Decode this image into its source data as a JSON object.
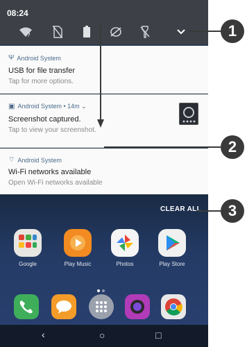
{
  "status_bar": {
    "time": "08:24",
    "quick_settings": [
      {
        "name": "wifi-unknown-icon"
      },
      {
        "name": "no-sim-icon"
      },
      {
        "name": "battery-icon"
      },
      {
        "name": "location-off-icon"
      },
      {
        "name": "flashlight-off-icon"
      },
      {
        "name": "expand-chevron-icon"
      }
    ]
  },
  "notifications": [
    {
      "app": "Android System",
      "title": "USB for file transfer",
      "subtitle": "Tap for more options.",
      "icon": "usb-icon"
    },
    {
      "app": "Android System • 14m ⌄",
      "title": "Screenshot captured.",
      "subtitle": "Tap to view your screenshot.",
      "icon": "image-icon"
    },
    {
      "app": "Android System",
      "title": "Wi-Fi networks available",
      "subtitle": "Open Wi-Fi networks available",
      "icon": "wifi-icon"
    }
  ],
  "home": {
    "clear_all": "CLEAR ALL",
    "apps": [
      {
        "label": "Google",
        "color": "#e8e6e3"
      },
      {
        "label": "Play Music",
        "color": "#f28b21"
      },
      {
        "label": "Photos",
        "color": "#f5f5f5"
      },
      {
        "label": "Play Store",
        "color": "#f0f0f0"
      }
    ],
    "dock": [
      {
        "name": "phone-app",
        "color": "#3fae5b"
      },
      {
        "name": "messages-app",
        "color": "#f39c2a"
      },
      {
        "name": "app-drawer",
        "color": "#9aa1ad"
      },
      {
        "name": "camera-app",
        "color": "#b23bb8"
      },
      {
        "name": "chrome-app",
        "color": "#e8e8e8"
      }
    ],
    "nav": {
      "back": "‹",
      "home": "○",
      "recents": "□"
    }
  },
  "callouts": [
    "1",
    "2",
    "3"
  ]
}
